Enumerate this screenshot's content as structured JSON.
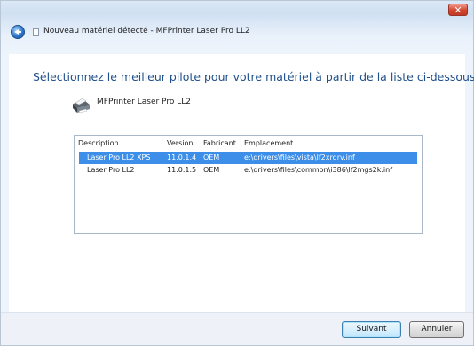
{
  "window": {
    "title": "Nouveau matériel détecté - MFPrinter Laser Pro LL2",
    "close_glyph": "✕",
    "accent": "#1e4f8a"
  },
  "page": {
    "heading": "Sélectionnez le meilleur pilote pour votre matériel à partir de la liste ci-dessous.",
    "device_name": "MFPrinter Laser Pro LL2"
  },
  "driver_list": {
    "columns": [
      "Description",
      "Version",
      "Fabricant",
      "Emplacement"
    ],
    "rows": [
      {
        "description": "Laser Pro LL2 XPS",
        "version": "11.0.1.4",
        "fabricant": "OEM",
        "emplacement": "e:\\drivers\\files\\vista\\lf2xrdrv.inf",
        "selected": true
      },
      {
        "description": "Laser Pro LL2",
        "version": "11.0.1.5",
        "fabricant": "OEM",
        "emplacement": "e:\\drivers\\files\\common\\i386\\lf2mgs2k.inf",
        "selected": false
      }
    ]
  },
  "buttons": {
    "next": "Suivant",
    "cancel": "Annuler"
  }
}
